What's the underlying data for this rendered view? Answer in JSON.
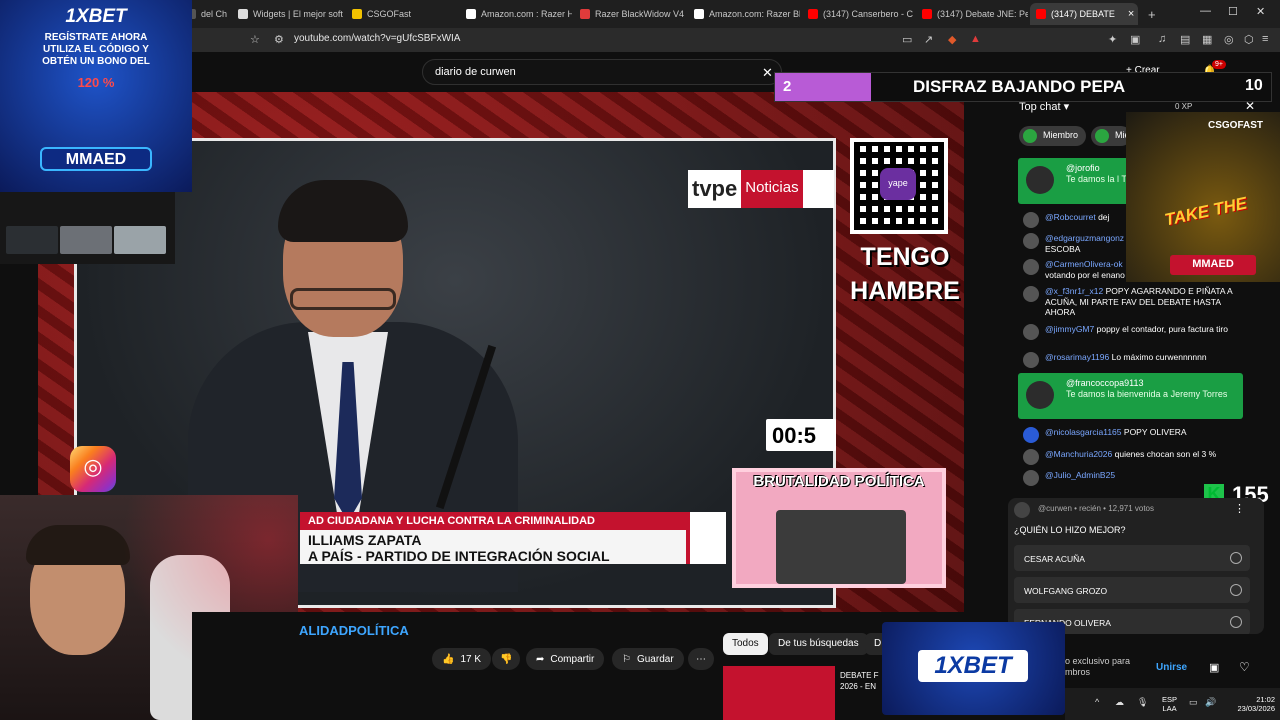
{
  "browser": {
    "tabs": [
      {
        "label": "del Ch",
        "color": "#555"
      },
      {
        "label": "Widgets | El mejor soft",
        "color": "#ddd"
      },
      {
        "label": "CSGOFast",
        "color": "#f2c200"
      },
      {
        "label": "Amazon.com : Razer H",
        "color": "#fff"
      },
      {
        "label": "Razer BlackWidow V4",
        "color": "#e03b3b"
      },
      {
        "label": "Amazon.com: Razer Bl",
        "color": "#fff"
      },
      {
        "label": "(3147) Canserbero - C",
        "color": "#ff0000"
      },
      {
        "label": "(3147) Debate JNE: Pe",
        "color": "#ff0000"
      },
      {
        "label": "(3147) DEBATE",
        "color": "#ff0000"
      }
    ],
    "new_tab": "+",
    "url": "youtube.com/watch?v=gUfcSBFxWIA",
    "window_controls": [
      "—",
      "☐",
      "✕"
    ]
  },
  "youtube": {
    "search_value": "diario de curwen",
    "channel_name_partial": "ALIDADPOLÍTICA",
    "likes": "17 K",
    "share_label": "Compartir",
    "save_label": "Guardar",
    "filter_chips": [
      "Todos",
      "De tus búsquedas",
      "D"
    ],
    "related_title": "DEBATE F 2026 - EN",
    "members_text": "o exclusivo para\nmbros",
    "join_label": "Unirse",
    "create_label": "Crear",
    "notif_count": "9+"
  },
  "video": {
    "network": "tvpe",
    "network_sub": "Noticias",
    "qr_brand": "yape",
    "overlay_text": "TENGO HAMBRE",
    "timer": "00:5",
    "lower_third_top": "AD CIUDADANA Y LUCHA CONTRA LA CRIMINALIDAD",
    "lower_third_name": "ILLIAMS ZAPATA",
    "lower_third_party": "A PAÍS - PARTIDO DE INTEGRACIÓN SOCIAL",
    "pip_title": "BRUTALIDAD POLÍTICA"
  },
  "ads": {
    "top_left_brand": "1XBET",
    "top_left_text": "REGÍSTRATE AHORA UTILIZA EL CÓDIGO Y OBTÉN UN BONO DEL",
    "top_left_bonus": "120 %",
    "top_left_code": "MMAED",
    "csgo_brand": "CSGOFAST",
    "csgo_tagline": "TAKE THE",
    "csgo_code": "MMAED",
    "bottom_brand": "1XBET"
  },
  "stream_banner": {
    "left_num": "2",
    "text": "DISFRAZ BAJANDO PEPA",
    "right_num": "10"
  },
  "chat": {
    "header": "Top chat",
    "xp": "0 XP",
    "chips": [
      "Miembro",
      "Mie"
    ],
    "messages": [
      {
        "user": "@Robcourret",
        "text": "dej"
      },
      {
        "user": "@edgarguzmangonz",
        "text": "ESCOBA"
      },
      {
        "user": "@CarmenOlivera-ok",
        "text": "votando por el enano"
      },
      {
        "user": "@x_f3nr1r_x12",
        "text": "POPY AGARRANDO E PIÑATA A ACUÑA, MI PARTE FAV DEL DEBATE HASTA AHORA"
      },
      {
        "user": "@jimmyGM7",
        "text": "poppy el contador, pura factura tiro"
      },
      {
        "user": "@rosarimay1196",
        "text": "Lo máximo curwennnnnn"
      },
      {
        "user": "@nicolasgarcia1165",
        "text": "POPY OLIVERA"
      },
      {
        "user": "@Manchuria2026",
        "text": "quienes chocan son el 3 %"
      },
      {
        "user": "@Julio_AdminB25",
        "text": ""
      }
    ],
    "welcome_1": {
      "user": "@jorofio",
      "text": "Te damos la l Torres"
    },
    "welcome_2": {
      "user": "@francoccopa9113",
      "text": "Te damos la bienvenida a Jeremy Torres"
    },
    "score": "155",
    "poll": {
      "meta": "@curwen • recién • 12,971 votos",
      "question": "¿QUIÉN LO HIZO MEJOR?",
      "options": [
        "CESAR ACUÑA",
        "WOLFGANG GROZO",
        "FERNANDO OLIVERA"
      ]
    }
  },
  "taskbar": {
    "lang_1": "ESP",
    "lang_2": "LAA",
    "time": "21:02",
    "date": "23/03/2026"
  }
}
